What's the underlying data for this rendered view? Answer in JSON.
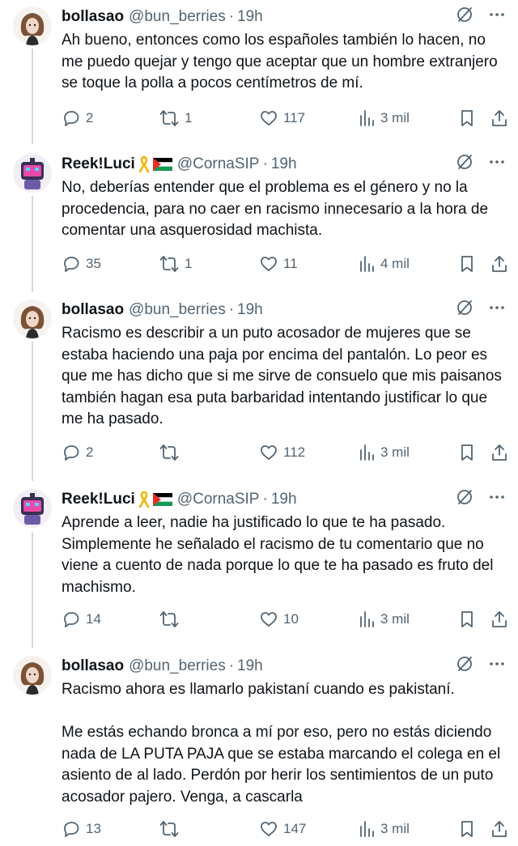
{
  "colors": {
    "text": "#0f1419",
    "secondary": "#536471",
    "thread_line": "#cfd9de"
  },
  "tweets": [
    {
      "name": "bollasao",
      "handle": "@bun_berries",
      "sep": "·",
      "time": "19h",
      "badges": [],
      "text": "Ah bueno, entonces como los españoles también lo hacen, no me puedo quejar y tengo que aceptar que un hombre extranjero se toque la polla a pocos centímetros de mí.",
      "replies": "2",
      "reposts": "1",
      "likes": "117",
      "views": "3 mil"
    },
    {
      "name": "Reek!Luci",
      "handle": "@CornaSIP",
      "sep": "·",
      "time": "19h",
      "badges": [
        "ribbon-icon",
        "palestine-flag-icon"
      ],
      "text": "No, deberías entender que el problema es el género y no la procedencia, para no caer en racismo innecesario a la hora de comentar una asquerosidad machista.",
      "replies": "35",
      "reposts": "1",
      "likes": "11",
      "views": "4 mil"
    },
    {
      "name": "bollasao",
      "handle": "@bun_berries",
      "sep": "·",
      "time": "19h",
      "badges": [],
      "text": "Racismo es describir a un puto acosador de mujeres que se estaba haciendo una paja por encima del pantalón. Lo peor es que me has dicho que si me sirve de consuelo que mis paisanos también hagan esa puta barbaridad intentando justificar lo que me ha pasado.",
      "replies": "2",
      "reposts": "",
      "likes": "112",
      "views": "3 mil"
    },
    {
      "name": "Reek!Luci",
      "handle": "@CornaSIP",
      "sep": "·",
      "time": "19h",
      "badges": [
        "ribbon-icon",
        "palestine-flag-icon"
      ],
      "text": "Aprende a leer, nadie ha justificado lo que te ha pasado. Simplemente he señalado el racismo de tu comentario que no viene a cuento de nada porque lo que te ha pasado es fruto del machismo.",
      "replies": "14",
      "reposts": "",
      "likes": "10",
      "views": "3 mil"
    },
    {
      "name": "bollasao",
      "handle": "@bun_berries",
      "sep": "·",
      "time": "19h",
      "badges": [],
      "text": "Racismo ahora es llamarlo pakistaní cuando es pakistaní.\n\nMe estás echando bronca a mí por eso, pero no estás diciendo nada de LA PUTA PAJA que se estaba marcando el colega en el asiento de al lado. Perdón por herir los sentimientos de un puto acosador pajero. Venga, a cascarla",
      "replies": "13",
      "reposts": "",
      "likes": "147",
      "views": "3 mil"
    }
  ]
}
